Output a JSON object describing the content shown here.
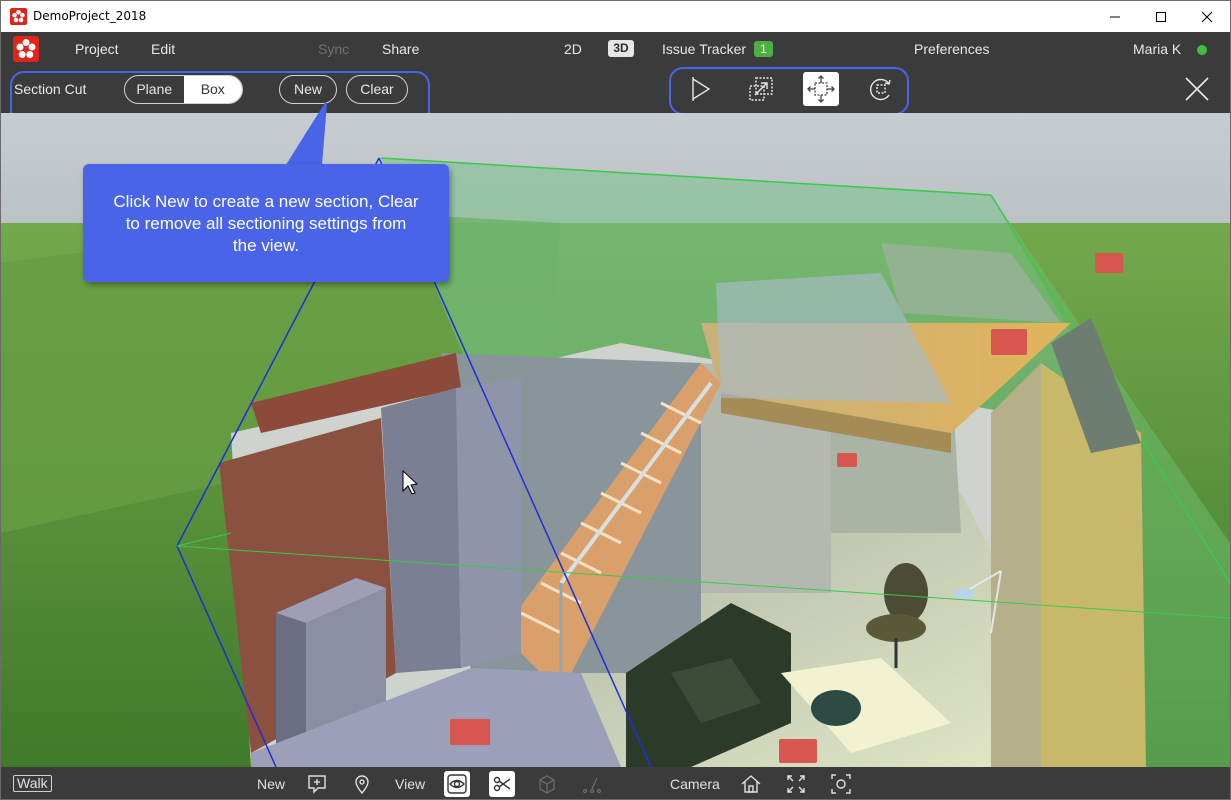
{
  "window": {
    "title": "DemoProject_2018"
  },
  "menu": {
    "project": "Project",
    "edit": "Edit",
    "sync": "Sync",
    "share": "Share",
    "view_2d": "2D",
    "view_3d": "3D",
    "issue_tracker": "Issue Tracker",
    "issue_count": "1",
    "preferences": "Preferences",
    "user": "Maria K"
  },
  "toolbar": {
    "section_cut_label": "Section Cut",
    "mode_plane": "Plane",
    "mode_box": "Box",
    "selected_mode": "Box",
    "new_label": "New",
    "clear_label": "Clear",
    "tools": [
      "section-plane-icon",
      "scale-icon",
      "move-icon",
      "rotate-icon"
    ],
    "active_tool": "move-icon"
  },
  "callout": {
    "text": "Click New to create a new section, Clear to remove all sectioning settings from the view."
  },
  "bottom": {
    "walk": "Walk",
    "new": "New",
    "view": "View",
    "camera": "Camera"
  },
  "colors": {
    "accent_blue": "#4a64e8",
    "brand_red": "#e2231a",
    "status_green": "#3fbf3f",
    "issue_badge_green": "#4caf3f",
    "bar_dark": "#3b3b3b"
  }
}
